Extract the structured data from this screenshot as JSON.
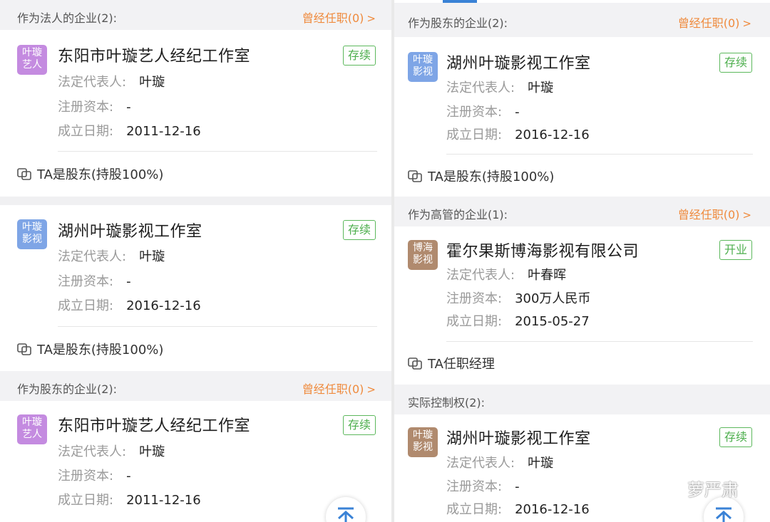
{
  "left": {
    "header1": {
      "title": "作为法人的企业(2):",
      "link": "曾经任职(0)"
    },
    "cards1": [
      {
        "logo": [
          "叶璇",
          "艺人"
        ],
        "logo_color": "#c48be0",
        "name": "东阳市叶璇艺人经纪工作室",
        "status": "存续",
        "rep_label": "法定代表人:",
        "rep": "叶璇",
        "cap_label": "注册资本:",
        "cap": "-",
        "date_label": "成立日期:",
        "date": "2011-12-16",
        "role": "TA是股东(持股100%)"
      },
      {
        "logo": [
          "叶璇",
          "影视"
        ],
        "logo_color": "#7ea5e6",
        "name": "湖州叶璇影视工作室",
        "status": "存续",
        "rep_label": "法定代表人:",
        "rep": "叶璇",
        "cap_label": "注册资本:",
        "cap": "-",
        "date_label": "成立日期:",
        "date": "2016-12-16",
        "role": "TA是股东(持股100%)"
      }
    ],
    "header2": {
      "title": "作为股东的企业(2):",
      "link": "曾经任职(0)"
    },
    "cards2": [
      {
        "logo": [
          "叶璇",
          "艺人"
        ],
        "logo_color": "#c48be0",
        "name": "东阳市叶璇艺人经纪工作室",
        "status": "存续",
        "rep_label": "法定代表人:",
        "rep": "叶璇",
        "cap_label": "注册资本:",
        "cap": "-",
        "date_label": "成立日期:",
        "date": "2011-12-16"
      }
    ]
  },
  "right": {
    "header1": {
      "title": "作为股东的企业(2):",
      "link": "曾经任职(0)"
    },
    "cards1": [
      {
        "logo": [
          "叶璇",
          "影视"
        ],
        "logo_color": "#7ea5e6",
        "name": "湖州叶璇影视工作室",
        "status": "存续",
        "rep_label": "法定代表人:",
        "rep": "叶璇",
        "cap_label": "注册资本:",
        "cap": "-",
        "date_label": "成立日期:",
        "date": "2016-12-16",
        "role": "TA是股东(持股100%)"
      }
    ],
    "header2": {
      "title": "作为高管的企业(1):",
      "link": "曾经任职(0)"
    },
    "cards2": [
      {
        "logo": [
          "博海",
          "影视"
        ],
        "logo_color": "#b08a6e",
        "name": "霍尔果斯博海影视有限公司",
        "status": "开业",
        "rep_label": "法定代表人:",
        "rep": "叶春晖",
        "cap_label": "注册资本:",
        "cap": "300万人民币",
        "date_label": "成立日期:",
        "date": "2015-05-27",
        "role": "TA任职经理"
      }
    ],
    "header3": {
      "title": "实际控制权(2):"
    },
    "cards3": [
      {
        "logo": [
          "叶璇",
          "影视"
        ],
        "logo_color": "#b08a6e",
        "name": "湖州叶璇影视工作室",
        "status": "存续",
        "rep_label": "法定代表人:",
        "rep": "叶璇",
        "cap_label": "注册资本:",
        "cap": "-",
        "date_label": "成立日期:",
        "date": "2016-12-16"
      }
    ]
  },
  "watermark": "萝严肃",
  "colors": {
    "accent_orange": "#ef8a3c",
    "status_green": "#4cae4c",
    "section_bg": "#f2f2f4"
  },
  "icons": {
    "role_icon": "share-link-icon",
    "fab_icon": "scroll-to-top-icon",
    "watermark_icon": "wechat-icon"
  }
}
